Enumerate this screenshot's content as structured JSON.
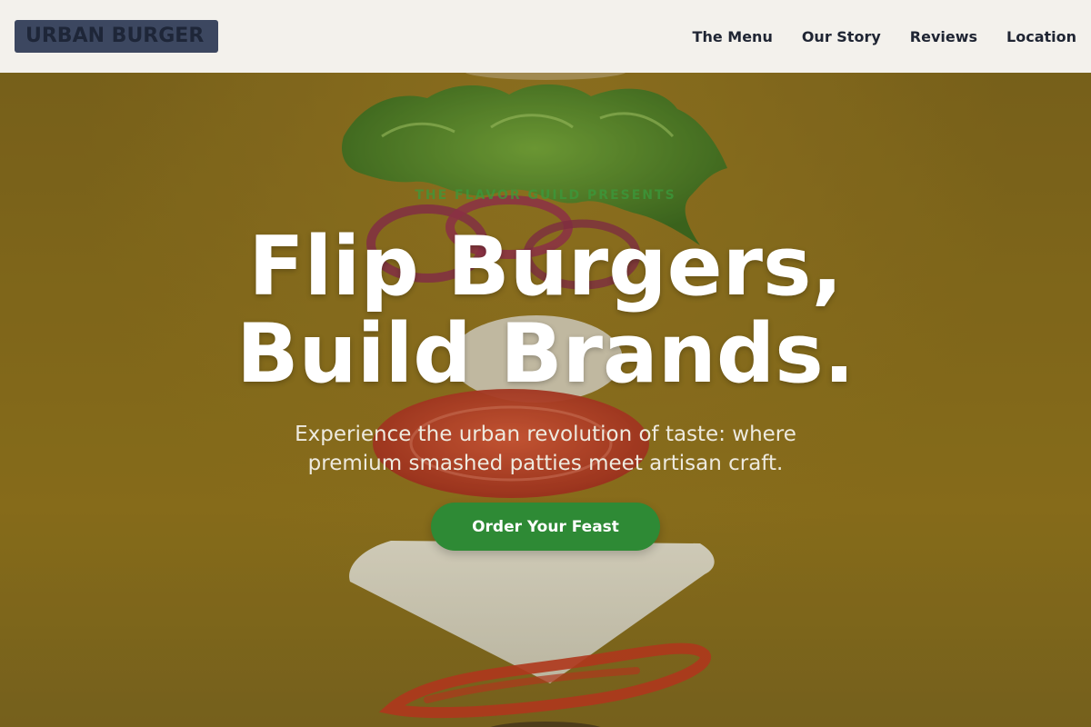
{
  "header": {
    "logo_text": "URBAN BURGER",
    "nav": [
      {
        "label": "The Menu"
      },
      {
        "label": "Our Story"
      },
      {
        "label": "Reviews"
      },
      {
        "label": "Location"
      }
    ]
  },
  "hero": {
    "eyebrow": "THE FLAVOR GUILD PRESENTS",
    "headline_line1": "Flip Burgers,",
    "headline_line2": "Build Brands.",
    "subtext": "Experience the urban revolution of taste: where premium smashed patties meet artisan craft.",
    "cta_label": "Order Your Feast"
  },
  "colors": {
    "header_bg": "#f3f1ec",
    "logo_bg": "#3c4760",
    "nav_text": "#1f2533",
    "hero_bg": "#8a6d1c",
    "accent_green": "#2e8a35",
    "headline": "#ffffff"
  }
}
